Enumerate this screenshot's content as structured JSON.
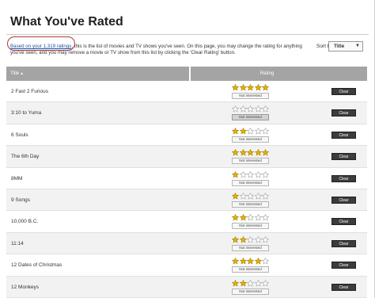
{
  "page": {
    "title": "What You've Rated",
    "intro_link": "Based on your 1,319 ratings",
    "intro_text": ", this is the list of movies and TV shows you've seen. On this page, you may change the rating for anything you've seen, and you may remove a movie or TV show from this list by clicking the 'Clear Rating' button.",
    "sort_label": "Sort by:",
    "sort_value": "Title"
  },
  "table": {
    "col_title": "Title",
    "col_rating": "Rating",
    "not_interested": "Not interested",
    "clear_label": "Clear",
    "rows": [
      {
        "title": "2 Fast 2 Furious",
        "stars": 5,
        "not_interested": false
      },
      {
        "title": "3:10 to Yuma",
        "stars": 0,
        "not_interested": true
      },
      {
        "title": "6 Souls",
        "stars": 2,
        "not_interested": false
      },
      {
        "title": "The 6th Day",
        "stars": 5,
        "not_interested": false
      },
      {
        "title": "8MM",
        "stars": 1,
        "not_interested": false
      },
      {
        "title": "9 Songs",
        "stars": 1,
        "not_interested": false
      },
      {
        "title": "10,000 B.C.",
        "stars": 2,
        "not_interested": false
      },
      {
        "title": "11:14",
        "stars": 2,
        "not_interested": false
      },
      {
        "title": "12 Dates of Christmas",
        "stars": 4,
        "not_interested": false
      },
      {
        "title": "12 Monkeys",
        "stars": 2,
        "not_interested": false
      }
    ]
  },
  "colors": {
    "star_filled": "#e5b100",
    "star_empty": "#ffffff",
    "header_bg": "#a4a4a4",
    "link": "#1b4ea3",
    "annotation_circle": "#b03a3a"
  }
}
